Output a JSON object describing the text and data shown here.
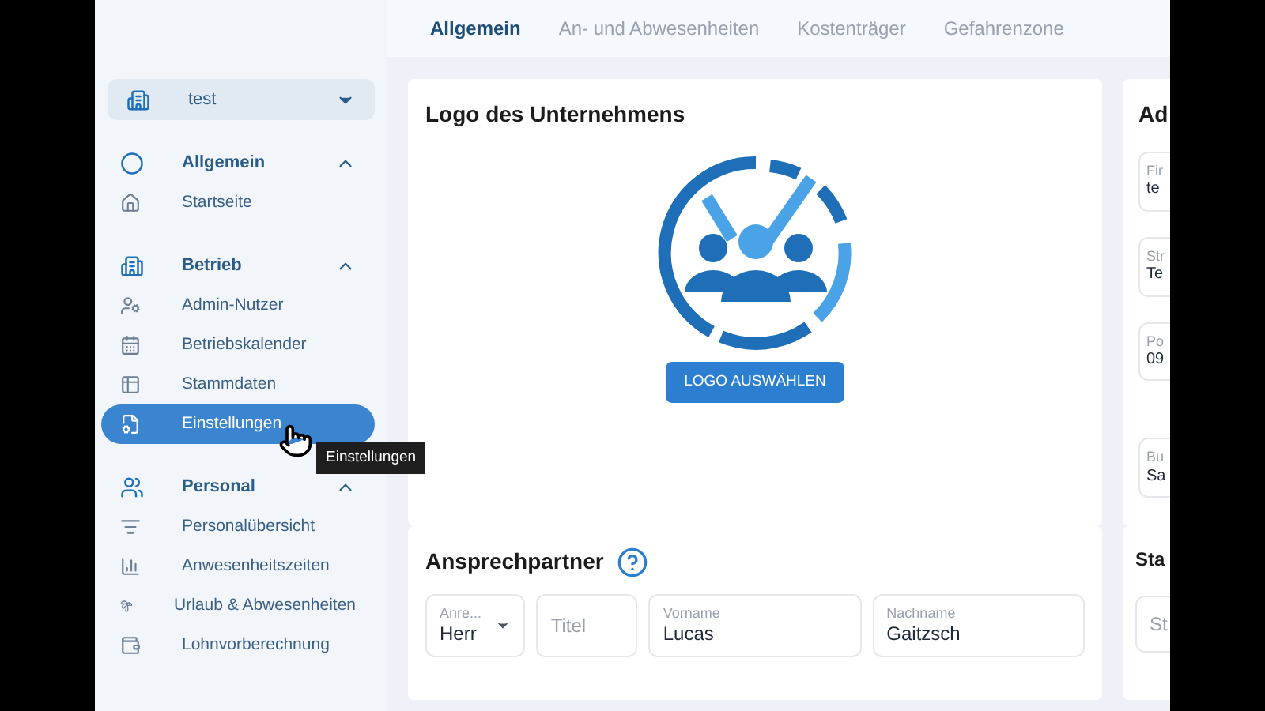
{
  "tabs": [
    {
      "label": "Allgemein",
      "selected": true
    },
    {
      "label": "An- und Abwesenheiten",
      "selected": false
    },
    {
      "label": "Kostenträger",
      "selected": false
    },
    {
      "label": "Gefahrenzone",
      "selected": false
    }
  ],
  "company_select": {
    "value": "test"
  },
  "sidebar": {
    "sections": [
      {
        "label": "Allgemein",
        "expanded": true,
        "items": [
          {
            "label": "Startseite",
            "selected": false
          }
        ]
      },
      {
        "label": "Betrieb",
        "expanded": true,
        "items": [
          {
            "label": "Admin-Nutzer",
            "selected": false
          },
          {
            "label": "Betriebskalender",
            "selected": false
          },
          {
            "label": "Stammdaten",
            "selected": false
          },
          {
            "label": "Einstellungen",
            "selected": true
          }
        ]
      },
      {
        "label": "Personal",
        "expanded": true,
        "items": [
          {
            "label": "Personalübersicht",
            "selected": false
          },
          {
            "label": "Anwesenheitszeiten",
            "selected": false
          },
          {
            "label": "Urlaub & Abwesenheiten",
            "selected": false
          },
          {
            "label": "Lohnvorberechnung",
            "selected": false
          }
        ]
      }
    ]
  },
  "tooltip": "Einstellungen",
  "logo_card": {
    "title": "Logo des Unternehmens",
    "button": "LOGO AUSWÄHLEN"
  },
  "address_card": {
    "title": "Ad",
    "fields": [
      {
        "label": "Fir",
        "value": "te"
      },
      {
        "label": "Str",
        "value": "Te"
      },
      {
        "label": "Po",
        "value": "09"
      },
      {
        "label": "Bu",
        "value": "Sa"
      }
    ]
  },
  "contact_card": {
    "title": "Ansprechpartner",
    "salutation": {
      "label": "Anre...",
      "value": "Herr"
    },
    "title_field": {
      "placeholder": "Titel"
    },
    "fields": [
      {
        "label": "Vorname",
        "value": "Lucas"
      },
      {
        "label": "Nachname",
        "value": "Gaitzsch"
      }
    ]
  },
  "status_card": {
    "title": "Sta",
    "field": {
      "placeholder": "St"
    }
  }
}
